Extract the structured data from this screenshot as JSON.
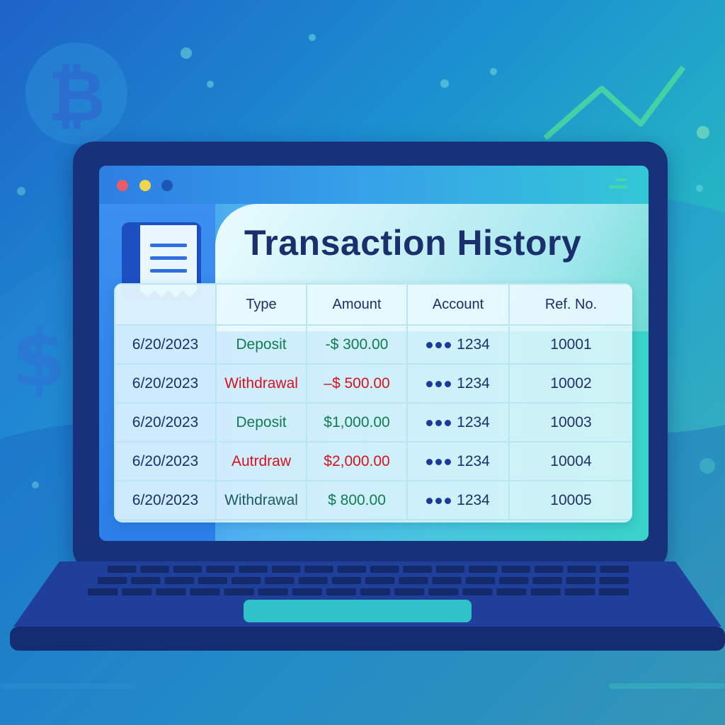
{
  "app": {
    "title": "Transaction History"
  },
  "table": {
    "headers": [
      "",
      "Type",
      "Amount",
      "Account",
      "Ref. No."
    ],
    "rows": [
      {
        "date": "6/20/2023",
        "type": "Deposit",
        "type_color": "#137a52",
        "amount": "-$ 300.00",
        "amount_color": "#137a52",
        "account": "1234",
        "ref": "10001"
      },
      {
        "date": "6/20/2023",
        "type": "Withdrawal",
        "type_color": "#d6121f",
        "amount": "–$ 500.00",
        "amount_color": "#d6121f",
        "account": "1234",
        "ref": "10002"
      },
      {
        "date": "6/20/2023",
        "type": "Deposit",
        "type_color": "#137a52",
        "amount": "$1,000.00",
        "amount_color": "#137a52",
        "account": "1234",
        "ref": "10003"
      },
      {
        "date": "6/20/2023",
        "type": "Autrdraw",
        "type_color": "#d6121f",
        "amount": "$2,000.00",
        "amount_color": "#d6121f",
        "account": "1234",
        "ref": "10004"
      },
      {
        "date": "6/20/2023",
        "type": "Withdrawal",
        "type_color": "#1e5a63",
        "amount": "$ 800.00",
        "amount_color": "#137a52",
        "account": "1234",
        "ref": "10005"
      }
    ]
  },
  "icons": {
    "window_controls": [
      "close-dot-icon",
      "minimize-dot-icon",
      "maximize-dot-icon"
    ],
    "menu": "menu-icon",
    "app": "receipt-icon",
    "background": [
      "bitcoin-icon",
      "dollar-icon",
      "trend-line-icon"
    ]
  },
  "colors": {
    "deposit": "#137a52",
    "withdrawal": "#d6121f",
    "laptop": "#17327a"
  }
}
